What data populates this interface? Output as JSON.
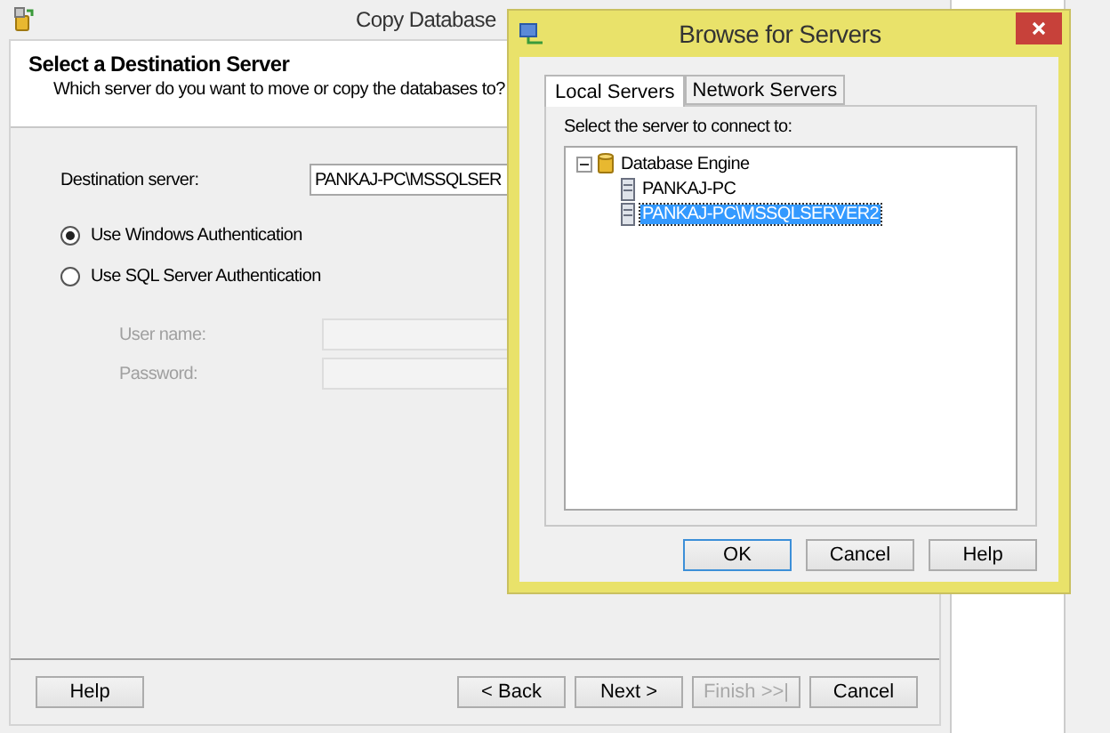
{
  "window": {
    "title": "Copy Database"
  },
  "header": {
    "title": "Select a Destination Server",
    "subtitle": "Which server do you want to move or copy the databases to?"
  },
  "destination": {
    "label": "Destination server:",
    "value": "PANKAJ-PC\\MSSQLSER"
  },
  "auth_options": [
    {
      "label": "Use Windows Authentication",
      "selected": true
    },
    {
      "label": "Use SQL Server Authentication",
      "selected": false
    }
  ],
  "credentials": [
    {
      "label": "User name:",
      "disabled": true
    },
    {
      "label": "Password:",
      "disabled": true
    }
  ],
  "footer_buttons": [
    {
      "label": "Help",
      "disabled": false
    },
    {
      "label": "< Back",
      "disabled": false
    },
    {
      "label": "Next >",
      "disabled": false
    },
    {
      "label": "Finish >>|",
      "disabled": true
    },
    {
      "label": "Cancel",
      "disabled": false
    }
  ],
  "dialog": {
    "title": "Browse for Servers",
    "tabs": [
      {
        "label": "Local Servers",
        "selected": true
      },
      {
        "label": "Network Servers",
        "selected": false
      }
    ],
    "prompt": "Select the server to connect to:",
    "tree": [
      {
        "label": "Database Engine",
        "expanded": true,
        "selected": false,
        "children": [
          {
            "label": "PANKAJ-PC",
            "selected": false
          },
          {
            "label": "PANKAJ-PC\\MSSQLSERVER2",
            "selected": true
          }
        ]
      }
    ],
    "buttons": [
      {
        "label": "OK",
        "default": true
      },
      {
        "label": "Cancel",
        "default": false
      },
      {
        "label": "Help",
        "default": false
      }
    ]
  }
}
